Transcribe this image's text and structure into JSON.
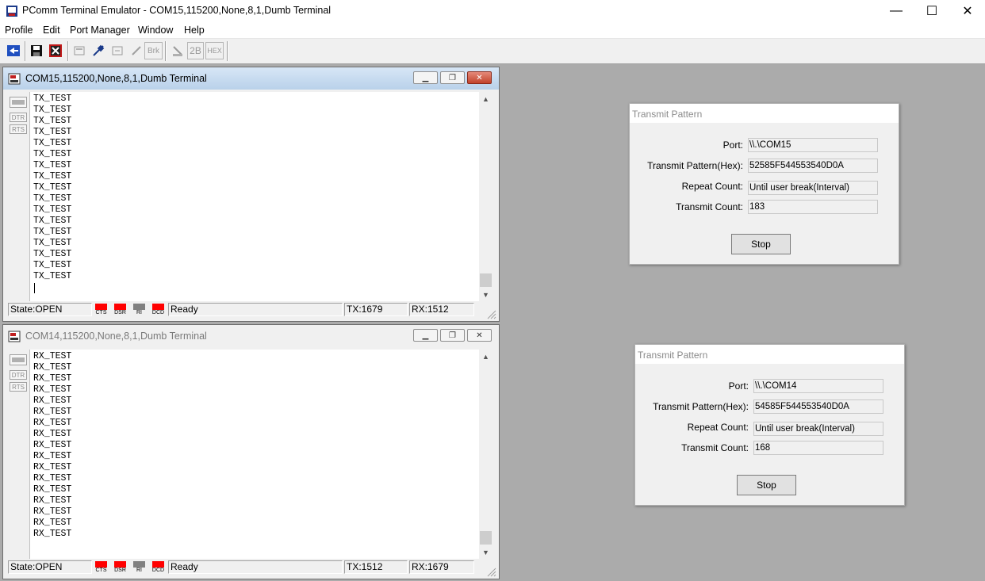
{
  "app": {
    "title": "PComm Terminal Emulator - COM15,115200,None,8,1,Dumb Terminal",
    "window_controls": {
      "minimize": "—",
      "maximize": "☐",
      "close": "✕"
    }
  },
  "menu": [
    "Profile",
    "Edit",
    "Port Manager",
    "Window",
    "Help"
  ],
  "toolbar": {
    "brk_label": "Brk",
    "tb2b_label": "2B",
    "hex_label": "HEX"
  },
  "terminals": [
    {
      "title": "COM15,115200,None,8,1,Dumb Terminal",
      "active": true,
      "side_buttons": [
        "DTR",
        "RTS"
      ],
      "lines": [
        "TX_TEST",
        "TX_TEST",
        "TX_TEST",
        "TX_TEST",
        "TX_TEST",
        "TX_TEST",
        "TX_TEST",
        "TX_TEST",
        "TX_TEST",
        "TX_TEST",
        "TX_TEST",
        "TX_TEST",
        "TX_TEST",
        "TX_TEST",
        "TX_TEST",
        "TX_TEST",
        "TX_TEST"
      ],
      "status": {
        "state": "State:OPEN",
        "leds": [
          {
            "label": "CTS",
            "color": "#ff0000"
          },
          {
            "label": "DSR",
            "color": "#ff0000"
          },
          {
            "label": "RI",
            "color": "#808080"
          },
          {
            "label": "DCD",
            "color": "#ff0000"
          }
        ],
        "message": "Ready",
        "tx": "TX:1679",
        "rx": "RX:1512"
      }
    },
    {
      "title": "COM14,115200,None,8,1,Dumb Terminal",
      "active": false,
      "side_buttons": [
        "DTR",
        "RTS"
      ],
      "lines": [
        "RX_TEST",
        "RX_TEST",
        "RX_TEST",
        "RX_TEST",
        "RX_TEST",
        "RX_TEST",
        "RX_TEST",
        "RX_TEST",
        "RX_TEST",
        "RX_TEST",
        "RX_TEST",
        "RX_TEST",
        "RX_TEST",
        "RX_TEST",
        "RX_TEST",
        "RX_TEST",
        "RX_TEST"
      ],
      "status": {
        "state": "State:OPEN",
        "leds": [
          {
            "label": "CTS",
            "color": "#ff0000"
          },
          {
            "label": "DSR",
            "color": "#ff0000"
          },
          {
            "label": "RI",
            "color": "#808080"
          },
          {
            "label": "DCD",
            "color": "#ff0000"
          }
        ],
        "message": "Ready",
        "tx": "TX:1512",
        "rx": "RX:1679"
      }
    }
  ],
  "dialogs": [
    {
      "title": "Transmit Pattern",
      "port_label": "Port:",
      "port": "\\\\.\\COM15",
      "pattern_label": "Transmit Pattern(Hex):",
      "pattern": "52585F544553540D0A",
      "repeat_label": "Repeat Count:",
      "repeat": "Until user break(Interval)",
      "count_label": "Transmit Count:",
      "count": "183",
      "stop_label": "Stop"
    },
    {
      "title": "Transmit Pattern",
      "port_label": "Port:",
      "port": "\\\\.\\COM14",
      "pattern_label": "Transmit Pattern(Hex):",
      "pattern": "54585F544553540D0A",
      "repeat_label": "Repeat Count:",
      "repeat": "Until user break(Interval)",
      "count_label": "Transmit Count:",
      "count": "168",
      "stop_label": "Stop"
    }
  ]
}
